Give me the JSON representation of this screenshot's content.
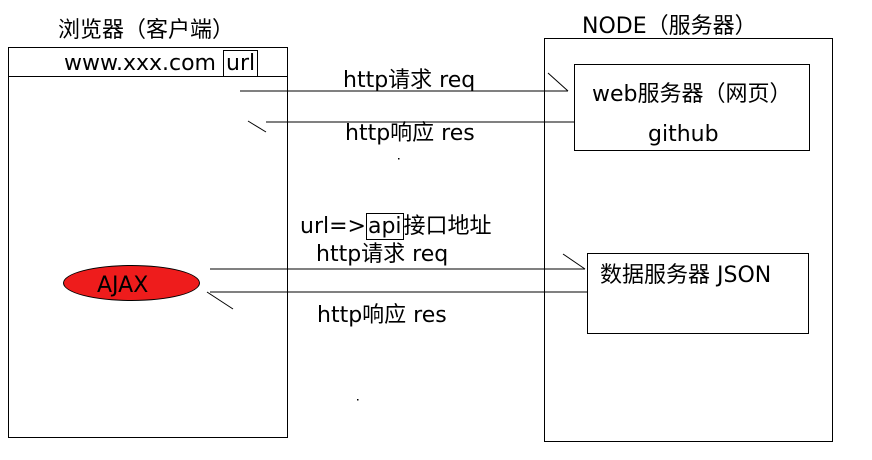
{
  "browser": {
    "title": "浏览器（客户端）",
    "url_prefix": "www.xxx.com",
    "url_label": "url",
    "ajax_label": "AJAX"
  },
  "node": {
    "title": "NODE（服务器）",
    "web_server": {
      "line1": "web服务器（网页）",
      "line2": "github"
    },
    "data_server": {
      "label": "数据服务器 JSON"
    }
  },
  "top_arrows": {
    "request": "http请求  req",
    "response": "http响应  res"
  },
  "api": {
    "prefix": "url=>",
    "api_word": "api",
    "suffix": "接口地址"
  },
  "bottom_arrows": {
    "request": "http请求   req",
    "response": "http响应   res"
  },
  "colors": {
    "ajax_fill": "#ee1c1c",
    "line": "#000000"
  }
}
